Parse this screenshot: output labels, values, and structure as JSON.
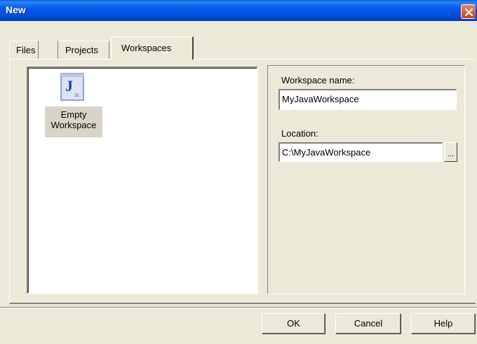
{
  "window": {
    "title": "New"
  },
  "tabs": [
    {
      "label": "Files"
    },
    {
      "label": "Projects"
    },
    {
      "label": "Workspaces",
      "active": true
    }
  ],
  "list": {
    "items": [
      {
        "label_line1": "Empty",
        "label_line2": "Workspace",
        "icon": "java-workspace-icon",
        "icon_glyph": "J",
        "icon_sub": "Jc"
      }
    ]
  },
  "form": {
    "workspace_name_label": "Workspace name:",
    "workspace_name_value": "MyJavaWorkspace",
    "location_label": "Location:",
    "location_value": "C:\\MyJavaWorkspace",
    "browse_label": "..."
  },
  "buttons": {
    "ok": "OK",
    "cancel": "Cancel",
    "help": "Help"
  },
  "colors": {
    "title_bar": "#0054e3",
    "dialog_bg": "#ece9d8",
    "close_button": "#d4542e"
  }
}
